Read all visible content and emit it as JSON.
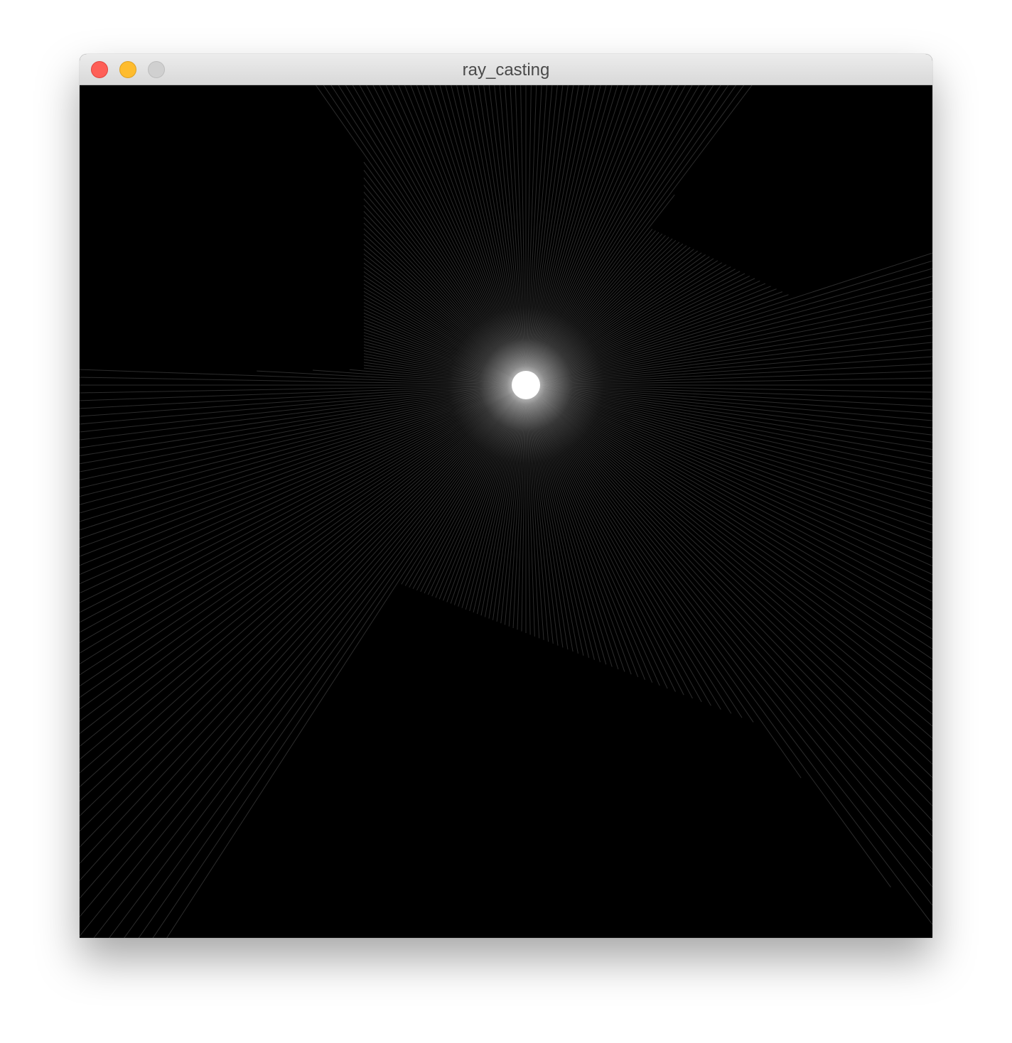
{
  "window": {
    "title": "ray_casting"
  },
  "traffic_lights": {
    "close": "close-button",
    "minimize": "minimize-button",
    "zoom": "zoom-button"
  },
  "scene": {
    "background": "#000000",
    "ray_color": "#c8c8c8",
    "light_color": "#ffffff",
    "ray_count": 360
  }
}
